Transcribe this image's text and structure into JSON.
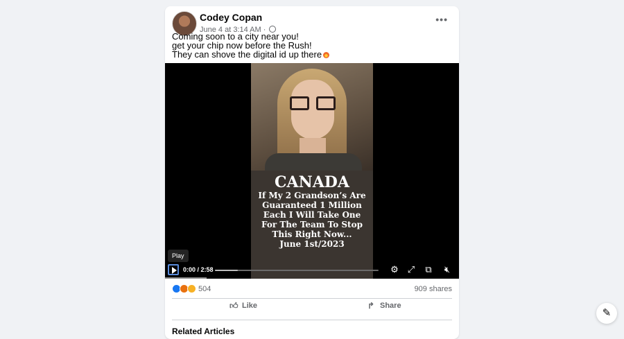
{
  "post": {
    "author": "Codey Copan",
    "timestamp": "June 4 at 3:14 AM",
    "separator": "·",
    "privacy_icon": "globe-icon",
    "text_lines": [
      "Coming soon to a city near you!",
      "get your chip now before the Rush!",
      "They can shove the digital id up there"
    ],
    "emoji_icon": "fire-icon"
  },
  "video": {
    "caption_title": "CANADA",
    "caption_lines": [
      "If My 2 Grandson’s Are",
      "Guaranteed 1 Million",
      "Each I Will Take One",
      "For The Team To Stop",
      "This Right Now...",
      "June 1st/2023"
    ],
    "tooltip": "Play",
    "time": "0:00 / 2:58",
    "progress_fraction": 0.14,
    "icons": [
      "play-icon",
      "gear-icon",
      "fullscreen-icon",
      "pip-icon",
      "mute-icon"
    ]
  },
  "engagement": {
    "reaction_icons": [
      "like-icon",
      "angry-icon",
      "wow-icon"
    ],
    "reaction_count": "504",
    "shares": "909 shares",
    "like_label": "Like",
    "share_label": "Share"
  },
  "related_heading": "Related Articles",
  "colors": {
    "accent": "#1877f2",
    "background": "#f0f2f5"
  }
}
